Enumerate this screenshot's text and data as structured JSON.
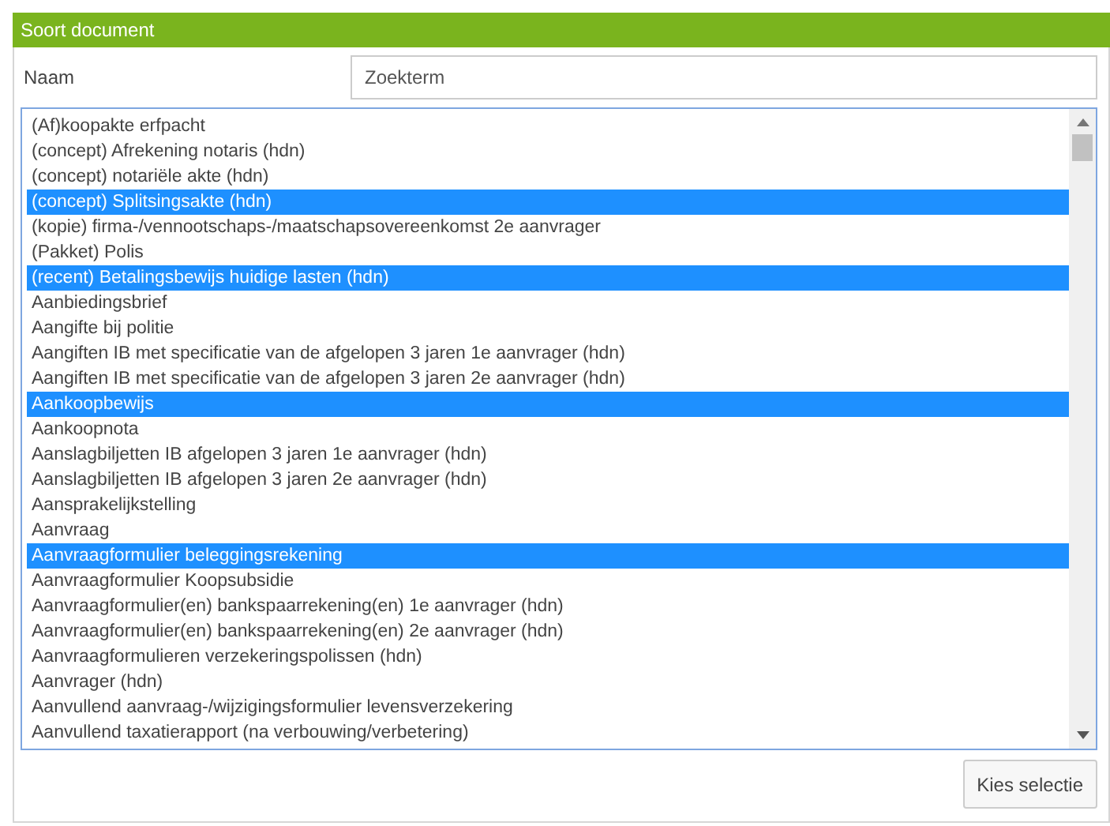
{
  "panel": {
    "title": "Soort document"
  },
  "search": {
    "label": "Naam",
    "placeholder": "Zoekterm"
  },
  "list": [
    {
      "label": "(Af)koopakte erfpacht",
      "selected": false
    },
    {
      "label": "(concept) Afrekening notaris (hdn)",
      "selected": false
    },
    {
      "label": "(concept) notariële akte (hdn)",
      "selected": false
    },
    {
      "label": "(concept) Splitsingsakte (hdn)",
      "selected": true
    },
    {
      "label": "(kopie) firma-/vennootschaps-/maatschapsovereenkomst 2e aanvrager",
      "selected": false
    },
    {
      "label": "(Pakket) Polis",
      "selected": false
    },
    {
      "label": "(recent) Betalingsbewijs huidige lasten (hdn)",
      "selected": true
    },
    {
      "label": "Aanbiedingsbrief",
      "selected": false
    },
    {
      "label": "Aangifte bij politie",
      "selected": false
    },
    {
      "label": "Aangiften IB met specificatie van de afgelopen 3 jaren 1e aanvrager (hdn)",
      "selected": false
    },
    {
      "label": "Aangiften IB met specificatie van de afgelopen 3 jaren 2e aanvrager (hdn)",
      "selected": false
    },
    {
      "label": "Aankoopbewijs",
      "selected": true
    },
    {
      "label": "Aankoopnota",
      "selected": false
    },
    {
      "label": "Aanslagbiljetten IB afgelopen 3 jaren 1e aanvrager (hdn)",
      "selected": false
    },
    {
      "label": "Aanslagbiljetten IB afgelopen 3 jaren 2e aanvrager (hdn)",
      "selected": false
    },
    {
      "label": "Aansprakelijkstelling",
      "selected": false
    },
    {
      "label": "Aanvraag",
      "selected": false
    },
    {
      "label": "Aanvraagformulier beleggingsrekening",
      "selected": true
    },
    {
      "label": "Aanvraagformulier Koopsubsidie",
      "selected": false
    },
    {
      "label": "Aanvraagformulier(en) bankspaarrekening(en) 1e aanvrager (hdn)",
      "selected": false
    },
    {
      "label": "Aanvraagformulier(en) bankspaarrekening(en) 2e aanvrager (hdn)",
      "selected": false
    },
    {
      "label": "Aanvraagformulieren verzekeringspolissen (hdn)",
      "selected": false
    },
    {
      "label": "Aanvrager (hdn)",
      "selected": false
    },
    {
      "label": "Aanvullend aanvraag-/wijzigingsformulier levensverzekering",
      "selected": false
    },
    {
      "label": "Aanvullend taxatierapport (na verbouwing/verbetering)",
      "selected": false
    }
  ],
  "button": "Kies selectie"
}
